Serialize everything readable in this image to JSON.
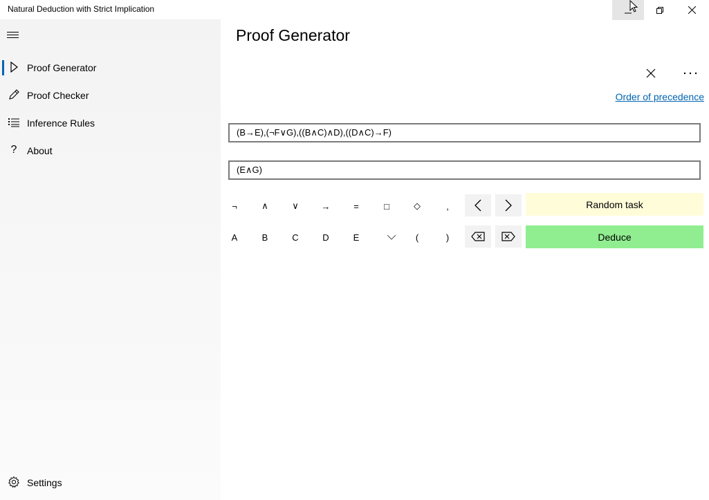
{
  "window": {
    "title": "Natural Deduction with Strict Implication"
  },
  "sidebar": {
    "items": [
      {
        "label": "Proof Generator",
        "icon": "play-outline-icon",
        "selected": true
      },
      {
        "label": "Proof Checker",
        "icon": "pencil-icon",
        "selected": false
      },
      {
        "label": "Inference Rules",
        "icon": "list-icon",
        "selected": false
      },
      {
        "label": "About",
        "icon": "question-icon",
        "selected": false
      }
    ],
    "settings_label": "Settings",
    "accent_color": "#0063b1"
  },
  "main": {
    "title": "Proof Generator",
    "precedence_link": "Order of precedence",
    "premises_value": "(B→E),(¬F∨G),((B∧C)∧D),((D∧C)→F)",
    "conclusion_value": "(E∧G)",
    "operator_keys": [
      "¬",
      "∧",
      "∨",
      "→",
      "=",
      "□",
      "◇",
      ","
    ],
    "variable_keys": [
      "A",
      "B",
      "C",
      "D",
      "E"
    ],
    "paren_keys": [
      "(",
      ")"
    ],
    "random_task_label": "Random task",
    "deduce_label": "Deduce",
    "colors": {
      "random_task_bg": "#fffcd9",
      "deduce_bg": "#90ee90",
      "link": "#0063b1"
    }
  }
}
